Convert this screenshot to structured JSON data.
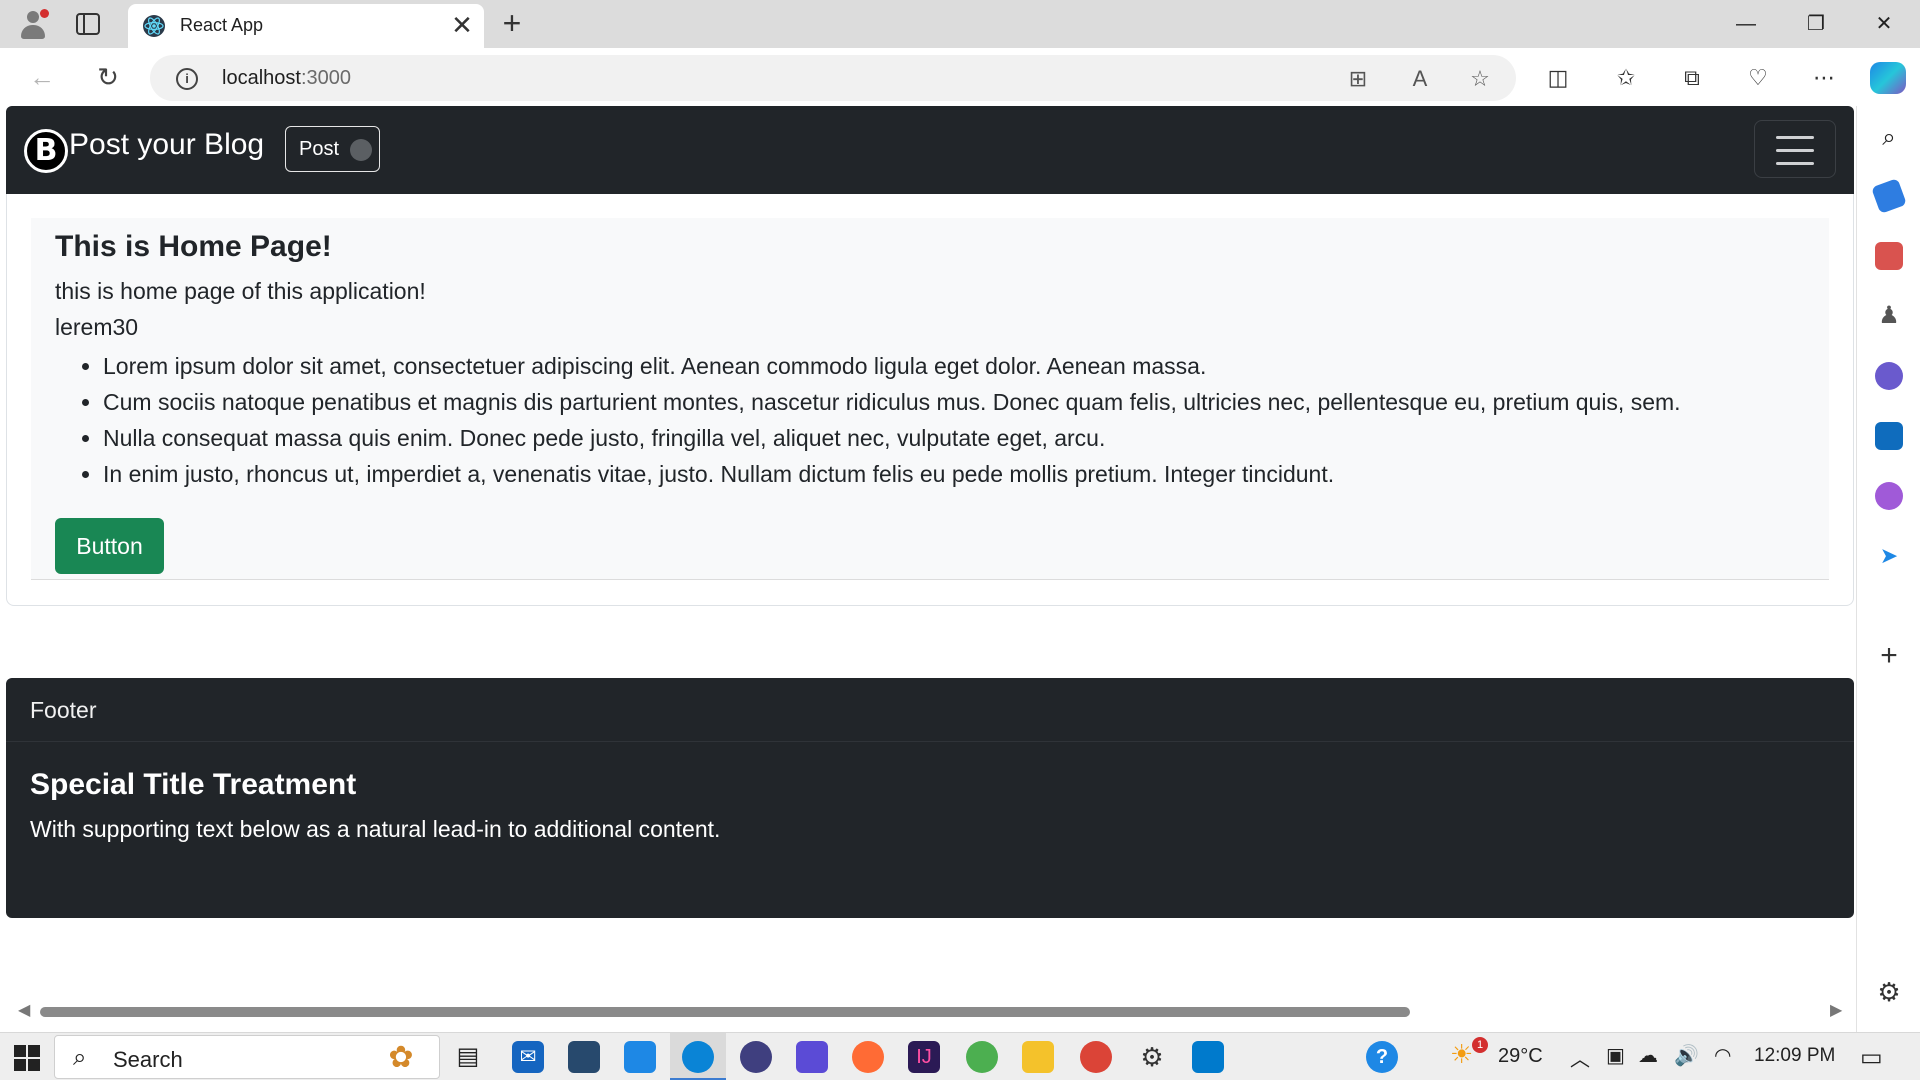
{
  "browser": {
    "tab_title": "React App",
    "tab_close": "✕",
    "new_tab": "+",
    "window": {
      "minimize": "—",
      "restore": "❐",
      "close": "✕"
    },
    "url_host": "localhost",
    "url_port": ":3000",
    "nav": {
      "back": "←",
      "reload": "↻"
    },
    "icons": {
      "apps": "⊞",
      "read_aloud": "A",
      "favorite": "☆",
      "split": "◫",
      "favorites": "✩",
      "collections": "⧉",
      "performance": "♡",
      "more": "⋯"
    }
  },
  "edge_sidebar": {
    "items": [
      "search-icon",
      "tag-icon",
      "toolbox-icon",
      "games-icon",
      "m365-icon",
      "outlook-icon",
      "designer-icon",
      "send-icon"
    ],
    "add": "+",
    "settings": "⚙"
  },
  "navbar": {
    "logo_letter": "B",
    "brand": "Post your Blog",
    "toggle_label": "Post"
  },
  "home": {
    "title": "This is Home Page!",
    "lead": "this is home page of this application!",
    "subtitle": "lerem30",
    "list": [
      "Lorem ipsum dolor sit amet, consectetuer adipiscing elit. Aenean commodo ligula eget dolor. Aenean massa.",
      "Cum sociis natoque penatibus et magnis dis parturient montes, nascetur ridiculus mus. Donec quam felis, ultricies nec, pellentesque eu, pretium quis, sem.",
      "Nulla consequat massa quis enim. Donec pede justo, fringilla vel, aliquet nec, vulputate eget, arcu.",
      "In enim justo, rhoncus ut, imperdiet a, venenatis vitae, justo. Nullam dictum felis eu pede mollis pretium. Integer tincidunt."
    ],
    "button": "Button"
  },
  "footer": {
    "header": "Footer",
    "title": "Special Title Treatment",
    "text": "With supporting text below as a natural lead-in to additional content."
  },
  "taskbar": {
    "search_placeholder": "Search",
    "weather_temp": "29°C",
    "time": "12:09 PM",
    "weather_badge": "1"
  },
  "colors": {
    "navbar_bg": "#212529",
    "button_green": "#198754",
    "jumbotron_bg": "#f8f9fa"
  }
}
